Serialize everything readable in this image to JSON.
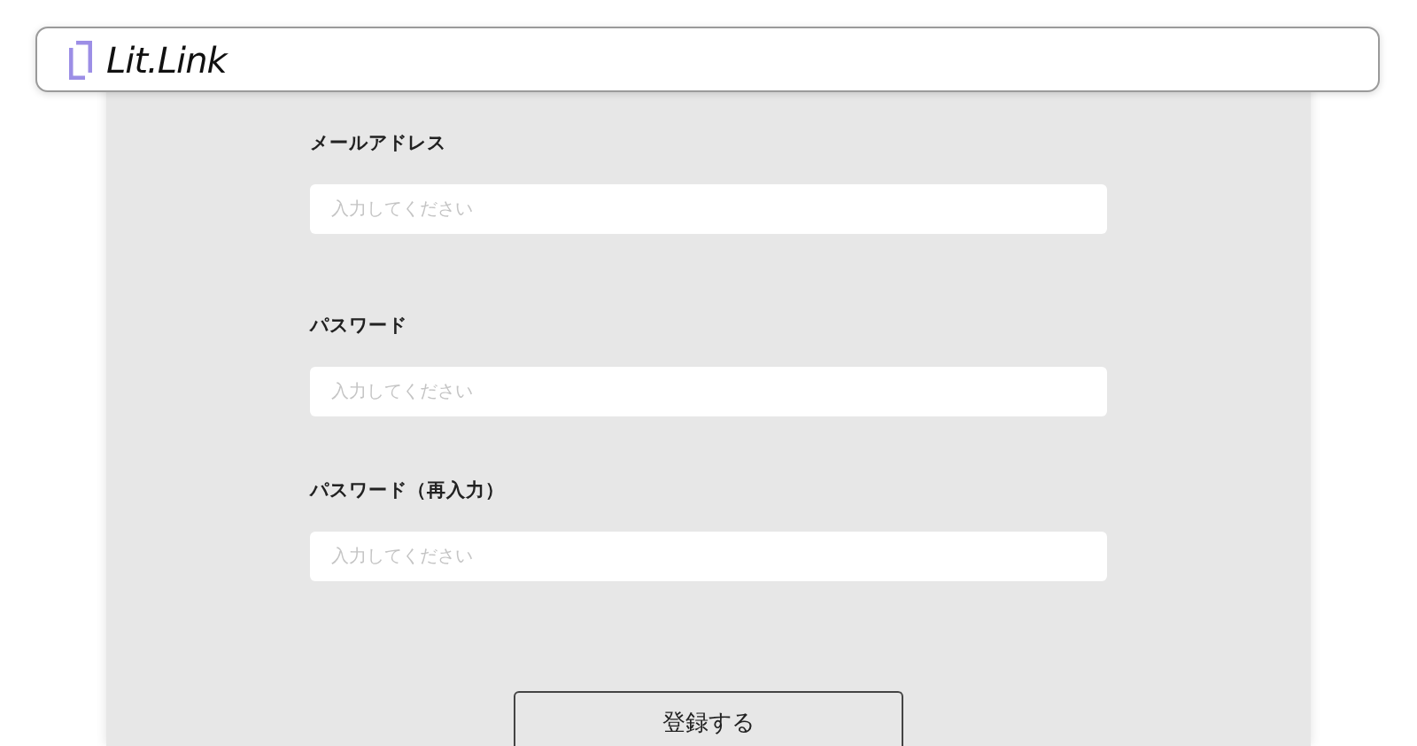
{
  "header": {
    "logo_text": "Lit.Link"
  },
  "fields": [
    {
      "label": "メールアドレス",
      "placeholder": "入力してください"
    },
    {
      "label": "パスワード",
      "placeholder": "入力してください"
    },
    {
      "label": "パスワード（再入力）",
      "placeholder": "入力してください"
    }
  ],
  "submit_button": "登録する"
}
